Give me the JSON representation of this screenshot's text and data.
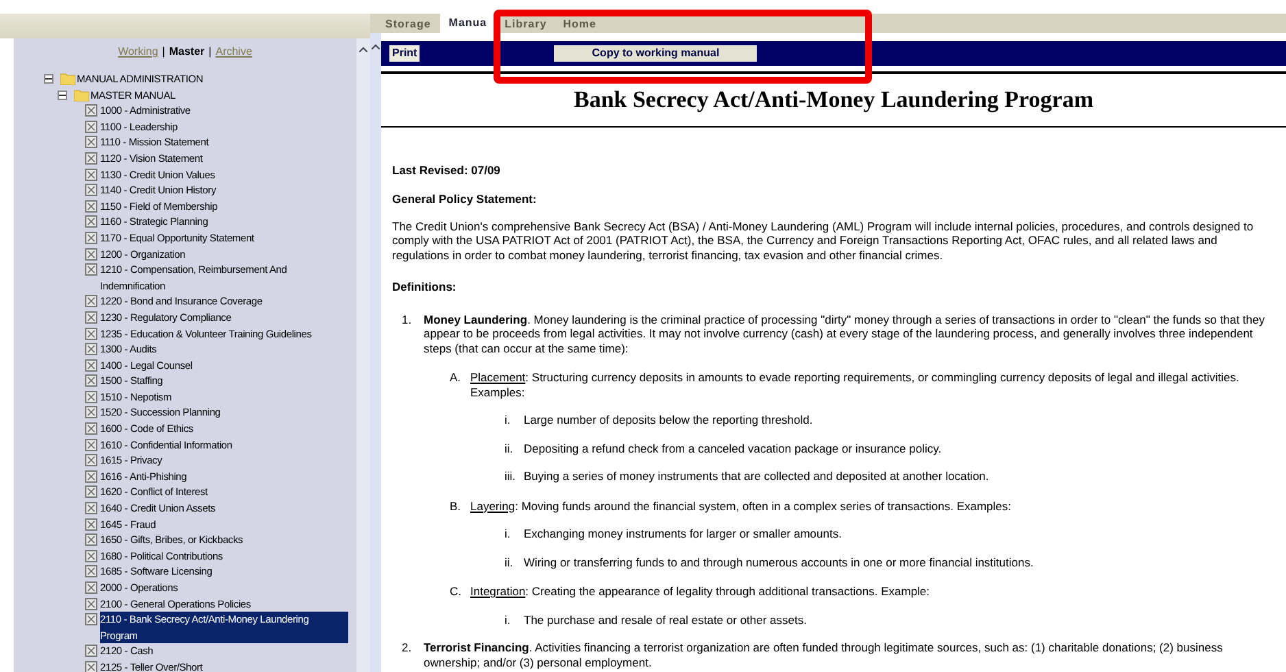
{
  "view_separator": "|",
  "view_links": [
    {
      "label": "Working",
      "selected": false
    },
    {
      "label": "Master",
      "selected": true
    },
    {
      "label": "Archive",
      "selected": false
    }
  ],
  "tree": [
    {
      "label": "MANUAL ADMINISTRATION",
      "expanded": true,
      "children": [
        {
          "label": "MASTER MANUAL",
          "expanded": true,
          "children": [
            {
              "label": "1000 - Administrative",
              "selected": false
            },
            {
              "label": "1100 - Leadership",
              "selected": false
            },
            {
              "label": "1110 - Mission Statement",
              "selected": false
            },
            {
              "label": "1120 - Vision Statement",
              "selected": false
            },
            {
              "label": "1130 - Credit Union Values",
              "selected": false
            },
            {
              "label": "1140 - Credit Union History",
              "selected": false
            },
            {
              "label": "1150 - Field of Membership",
              "selected": false
            },
            {
              "label": "1160 - Strategic Planning",
              "selected": false
            },
            {
              "label": "1170 - Equal Opportunity Statement",
              "selected": false
            },
            {
              "label": "1200 - Organization",
              "selected": false
            },
            {
              "label": "1210 - Compensation, Reimbursement And Indemnification",
              "selected": false
            },
            {
              "label": "1220 - Bond and Insurance Coverage",
              "selected": false
            },
            {
              "label": "1230 - Regulatory Compliance",
              "selected": false
            },
            {
              "label": "1235 - Education & Volunteer Training Guidelines",
              "selected": false
            },
            {
              "label": "1300 - Audits",
              "selected": false
            },
            {
              "label": "1400 - Legal Counsel",
              "selected": false
            },
            {
              "label": "1500 - Staffing",
              "selected": false
            },
            {
              "label": "1510 - Nepotism",
              "selected": false
            },
            {
              "label": "1520 - Succession Planning",
              "selected": false
            },
            {
              "label": "1600 - Code of Ethics",
              "selected": false
            },
            {
              "label": "1610 - Confidential Information",
              "selected": false
            },
            {
              "label": "1615 - Privacy",
              "selected": false
            },
            {
              "label": "1616 - Anti-Phishing",
              "selected": false
            },
            {
              "label": "1620 - Conflict of Interest",
              "selected": false
            },
            {
              "label": "1640 - Credit Union Assets",
              "selected": false
            },
            {
              "label": "1645 - Fraud",
              "selected": false
            },
            {
              "label": "1650 - Gifts, Bribes, or Kickbacks",
              "selected": false
            },
            {
              "label": "1680 - Political Contributions",
              "selected": false
            },
            {
              "label": "1685 - Software Licensing",
              "selected": false
            },
            {
              "label": "2000 - Operations",
              "selected": false
            },
            {
              "label": "2100 - General Operations Policies",
              "selected": false
            },
            {
              "label": "2110 - Bank Secrecy Act/Anti-Money Laundering Program",
              "selected": true
            },
            {
              "label": "2120 - Cash",
              "selected": false
            },
            {
              "label": "2125 - Teller Over/Short",
              "selected": false
            }
          ]
        }
      ]
    }
  ],
  "tabs": [
    {
      "label": "Storage",
      "selected": false
    },
    {
      "label": "Manua",
      "selected": true
    },
    {
      "label": "Library",
      "selected": false
    },
    {
      "label": "Home",
      "selected": false
    }
  ],
  "toolbar": {
    "buttons": [
      "Print",
      "Copy to working manual"
    ]
  },
  "document": {
    "title": "Bank Secrecy Act/Anti-Money Laundering Program",
    "last_revised": "Last Revised: 07/09",
    "policy_heading": "General Policy Statement:",
    "policy_text": "The Credit Union's comprehensive Bank Secrecy Act (BSA) / Anti-Money Laundering (AML) Program will include internal policies, procedures, and controls designed to comply with the USA PATRIOT Act of 2001 (PATRIOT Act), the BSA, the Currency and Foreign Transactions Reporting Act, OFAC rules, and all related laws and regulations in order to combat money laundering, terrorist financing, tax evasion and other financial crimes.",
    "definitions_heading": "Definitions:",
    "definitions": [
      {
        "number": "1.",
        "term": "Money Laundering",
        "text": ". Money laundering is the criminal practice of processing \"dirty\" money through a series of transactions in order to \"clean\" the funds so that they appear to be proceeds from legal activities. It may not involve currency (cash) at every stage of the laundering process, and generally involves three independent steps (that can occur at the same time):",
        "steps": [
          {
            "letter": "A.",
            "term": "Placement",
            "text": ": Structuring currency deposits in amounts to evade reporting requirements, or commingling currency deposits of legal and illegal activities. Examples:",
            "examples": [
              {
                "numeral": "i.",
                "text": "Large number of deposits below the reporting threshold."
              },
              {
                "numeral": "ii.",
                "text": "Depositing a refund check from a canceled vacation package or insurance policy."
              },
              {
                "numeral": "iii.",
                "text": "Buying a series of money instruments that are collected and deposited at another location."
              }
            ]
          },
          {
            "letter": "B.",
            "term": "Layering",
            "text": ": Moving funds around the financial system, often in a complex series of transactions. Examples:",
            "examples": [
              {
                "numeral": "i.",
                "text": "Exchanging money instruments for larger or smaller amounts."
              },
              {
                "numeral": "ii.",
                "text": "Wiring or transferring funds to and through numerous accounts in one or more financial institutions."
              }
            ]
          },
          {
            "letter": "C.",
            "term": "Integration",
            "text": ": Creating the appearance of legality through additional transactions. Example:",
            "examples": [
              {
                "numeral": "i.",
                "text": "The purchase and resale of real estate or other assets."
              }
            ]
          }
        ]
      },
      {
        "number": "2.",
        "term": "Terrorist Financing",
        "text": ". Activities financing a terrorist organization are often funded through legitimate sources, such as: (1) charitable donations; (2) business ownership; and/or (3) personal employment."
      }
    ]
  }
}
